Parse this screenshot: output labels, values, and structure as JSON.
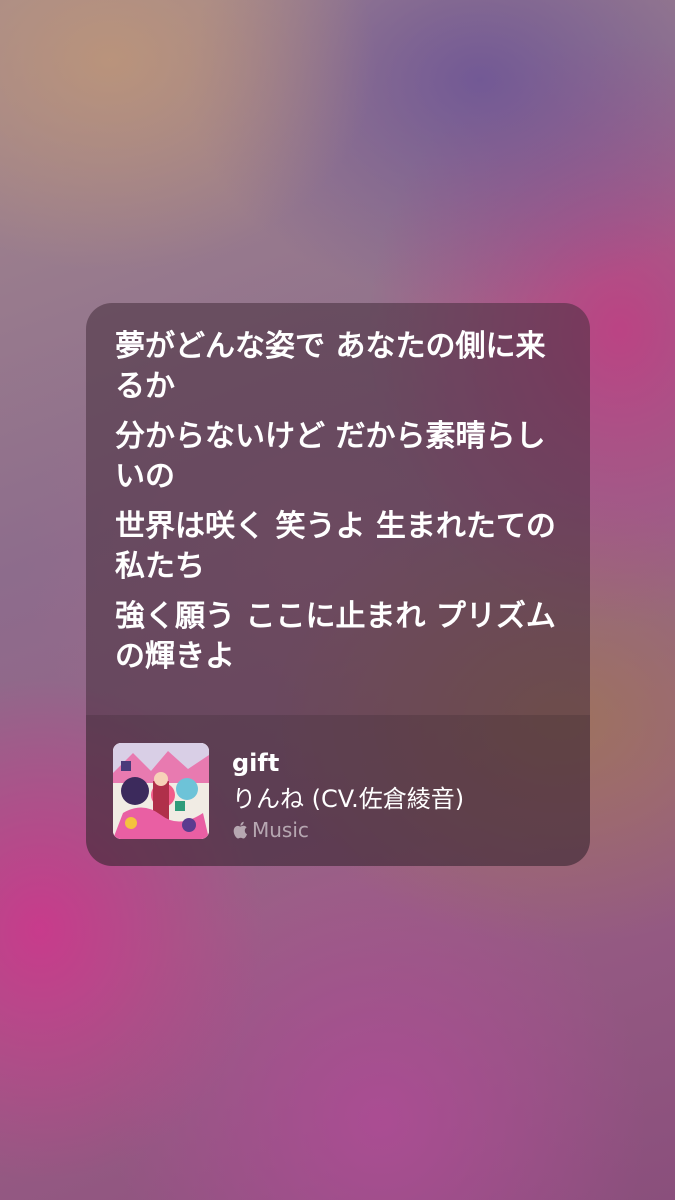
{
  "lyrics": {
    "lines": [
      "夢がどんな姿で あなたの側に来るか",
      "分からないけど だから素晴らしいの",
      "世界は咲く 笑うよ 生まれたての私たち",
      "強く願う ここに止まれ プリズムの輝きよ"
    ]
  },
  "song": {
    "title": "gift",
    "artist": "りんね (CV.佐倉綾音)",
    "service": "Music",
    "service_icon": "apple-logo-icon"
  },
  "colors": {
    "card_bg": "#462d3c",
    "text": "#ffffff",
    "secondary_text": "#c8b4c0"
  }
}
